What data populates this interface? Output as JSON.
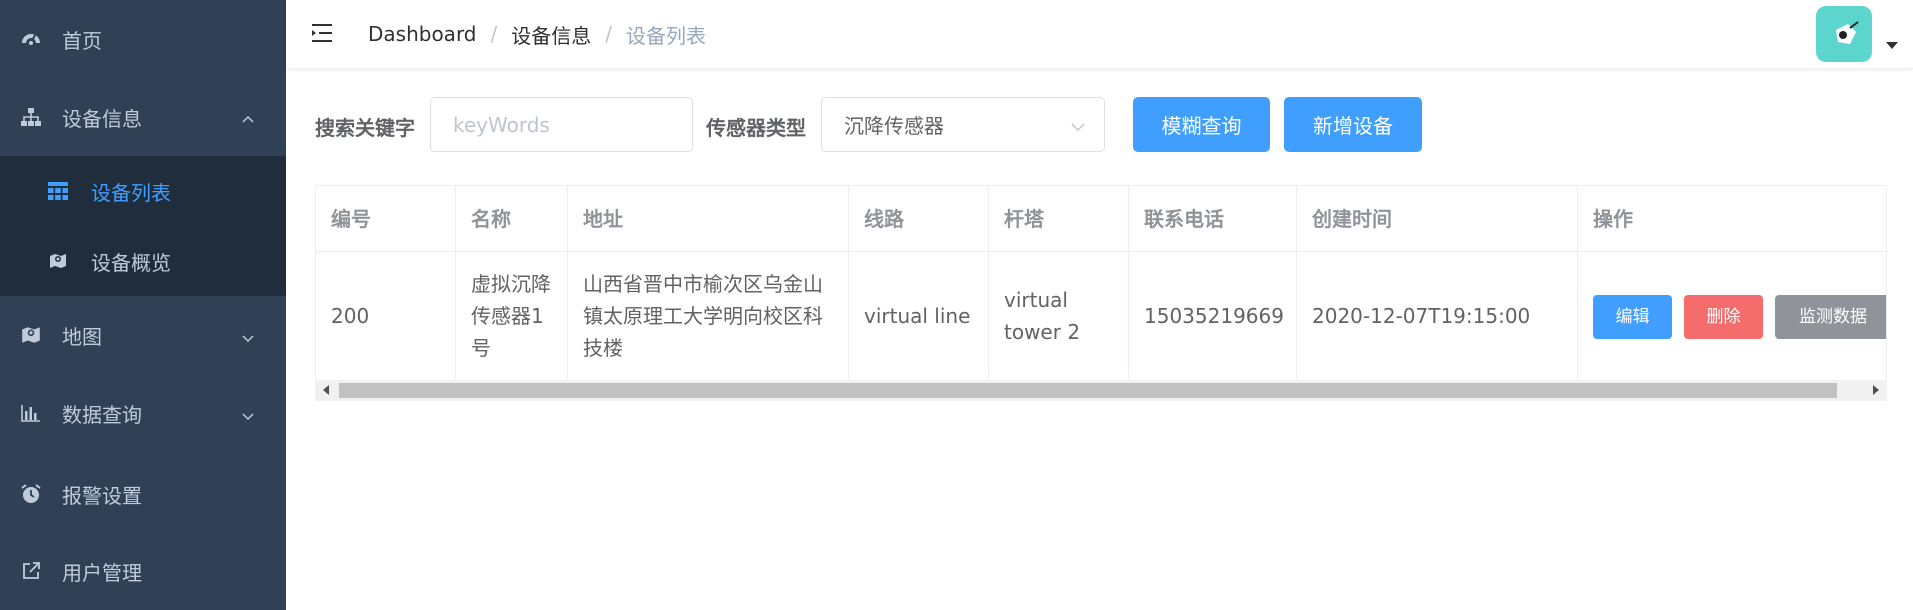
{
  "sidebar": {
    "items": [
      {
        "label": "首页",
        "icon": "dashboard-icon"
      },
      {
        "label": "设备信息",
        "icon": "sitemap-icon",
        "expanded": true
      },
      {
        "label": "地图",
        "icon": "map-icon"
      },
      {
        "label": "数据查询",
        "icon": "chart-icon"
      },
      {
        "label": "报警设置",
        "icon": "alarm-icon"
      },
      {
        "label": "用户管理",
        "icon": "external-link-icon"
      }
    ],
    "submenu": [
      {
        "label": "设备列表",
        "icon": "table-icon",
        "active": true
      },
      {
        "label": "设备概览",
        "icon": "map-icon"
      }
    ]
  },
  "breadcrumb": [
    "Dashboard",
    "设备信息",
    "设备列表"
  ],
  "filter": {
    "keyword_label": "搜索关键字",
    "keyword_placeholder": "keyWords",
    "keyword_value": "",
    "sensor_label": "传感器类型",
    "sensor_selected": "沉降传感器",
    "search_button": "模糊查询",
    "add_button": "新增设备"
  },
  "table": {
    "columns": [
      "编号",
      "名称",
      "地址",
      "线路",
      "杆塔",
      "联系电话",
      "创建时间",
      "操作"
    ],
    "rows": [
      {
        "id": "200",
        "name": "虚拟沉降传感器1号",
        "address": "山西省晋中市榆次区乌金山镇太原理工大学明向校区科技楼",
        "line": "virtual line",
        "tower": "virtual tower 2",
        "phone": "15035219669",
        "created": "2020-12-07T19:15:00",
        "actions": {
          "edit": "编辑",
          "delete": "删除",
          "monitor": "监测数据"
        }
      }
    ]
  },
  "colors": {
    "sidebar_bg": "#304156",
    "submenu_bg": "#1f2d3d",
    "primary": "#409eff",
    "danger": "#f56c6c",
    "info": "#909399",
    "avatar_bg": "#5dd5cf"
  }
}
